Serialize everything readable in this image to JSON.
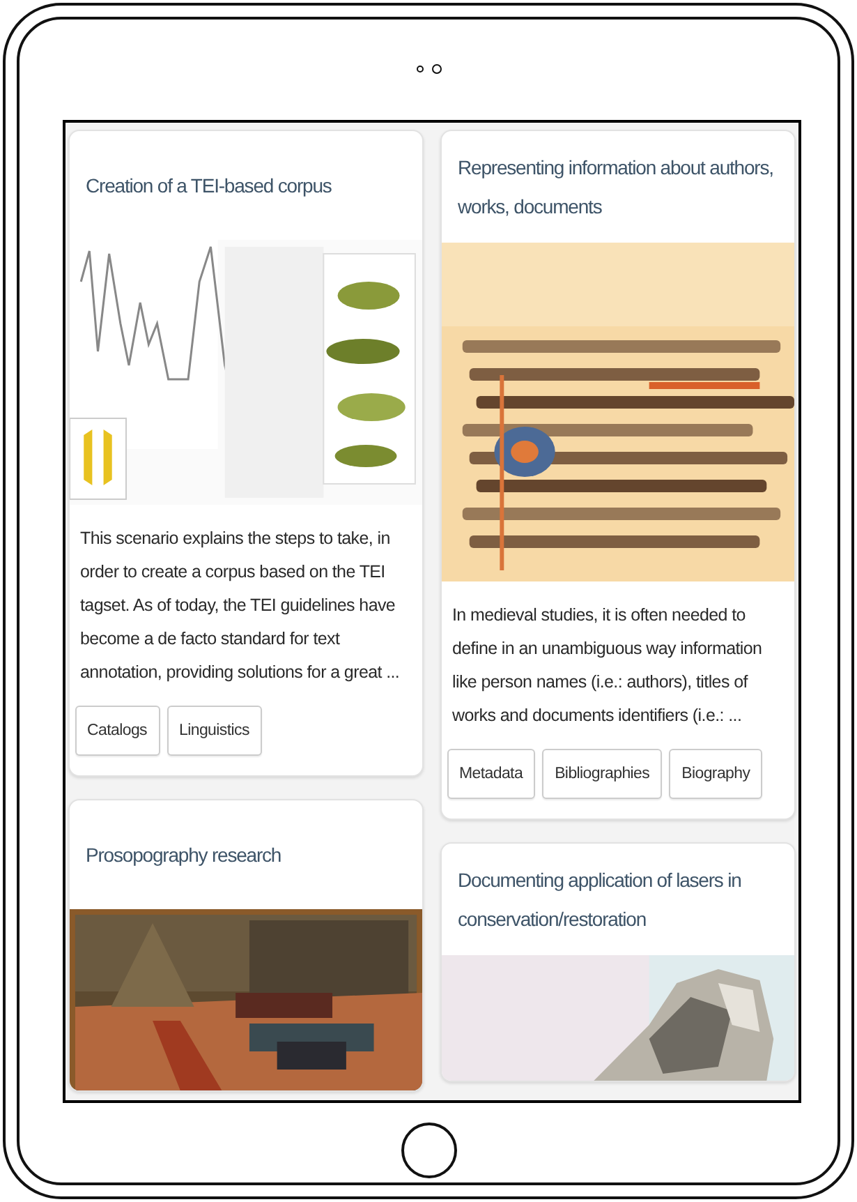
{
  "columns": [
    {
      "cards": [
        {
          "title": "Creation of a TEI-based corpus",
          "image": {
            "kind": "picture"
          },
          "description": "This scenario explains the steps to take, in order to create a corpus based on the TEI tagset. As of today, the TEI guidelines have become a de facto standard for text annotation, providing solutions for a great ...",
          "tags": [
            "Catalogs",
            "Linguistics"
          ]
        },
        {
          "title": "Prosopography research",
          "image": {
            "kind": "picture"
          }
        }
      ]
    },
    {
      "cards": [
        {
          "title": "Representing information about authors, works, documents",
          "image": {
            "kind": "picture"
          },
          "description": "In medieval studies, it is often needed to define in an unambiguous way information like person names (i.e.: authors), titles of works and documents identifiers (i.e.: ...",
          "tags": [
            "Metadata",
            "Bibliographies",
            "Biography"
          ]
        },
        {
          "title": "Documenting application of lasers in conservation/restoration",
          "image": {
            "kind": "picture"
          }
        }
      ]
    }
  ]
}
